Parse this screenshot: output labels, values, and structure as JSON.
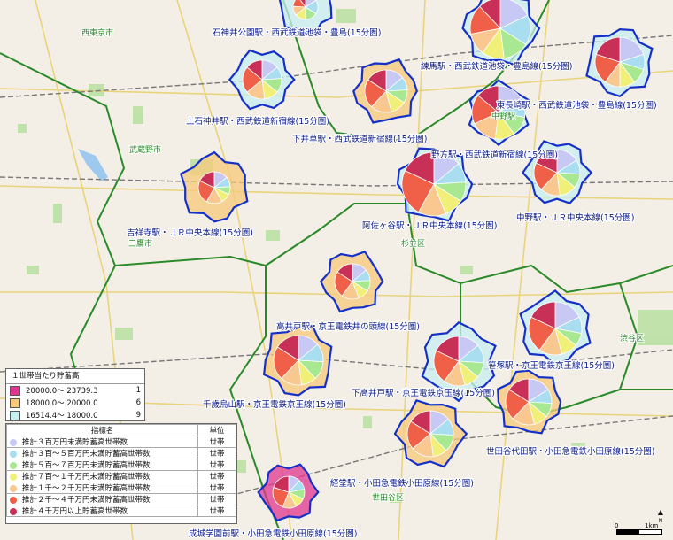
{
  "map": {
    "cities": [
      "西東京市",
      "武蔵野市",
      "三鷹市",
      "中野区",
      "杉並区",
      "渋谷区",
      "世田谷区"
    ],
    "stations": [
      {
        "label": "石神井公園駅・西武鉄道池袋・豊島(15分圏)",
        "tier": "c",
        "pie": [
          0.16,
          0.18,
          0.16,
          0.14,
          0.12,
          0.14,
          0.1
        ]
      },
      {
        "label": "練馬駅・西武鉄道池袋・豊島線(15分圏)",
        "tier": "c",
        "pie": [
          0.18,
          0.16,
          0.14,
          0.12,
          0.12,
          0.16,
          0.12
        ]
      },
      {
        "label": "上石神井駅・西武鉄道新宿線(15分圏)",
        "tier": "c",
        "pie": [
          0.14,
          0.1,
          0.12,
          0.12,
          0.16,
          0.22,
          0.14
        ]
      },
      {
        "label": "下井草駅・西武鉄道新宿線(15分圏)",
        "tier": "b",
        "pie": [
          0.14,
          0.1,
          0.1,
          0.12,
          0.16,
          0.22,
          0.16
        ]
      },
      {
        "label": "東長崎駅・西武鉄道池袋・豊島線(15分圏)",
        "tier": "c",
        "pie": [
          0.2,
          0.1,
          0.1,
          0.1,
          0.1,
          0.2,
          0.2
        ]
      },
      {
        "label": "野方駅・西武鉄道新宿線(15分圏)",
        "tier": "c",
        "pie": [
          0.16,
          0.12,
          0.12,
          0.12,
          0.16,
          0.18,
          0.14
        ]
      },
      {
        "label": "吉祥寺駅・ＪＲ中央本線(15分圏)",
        "tier": "b",
        "pie": [
          0.14,
          0.1,
          0.08,
          0.1,
          0.16,
          0.24,
          0.18
        ]
      },
      {
        "label": "阿佐ヶ谷駅・ＪＲ中央本線(15分圏)",
        "tier": "c",
        "pie": [
          0.14,
          0.1,
          0.1,
          0.1,
          0.14,
          0.24,
          0.18
        ]
      },
      {
        "label": "中野駅・ＪＲ中央本線(15分圏)",
        "tier": "c",
        "pie": [
          0.16,
          0.1,
          0.1,
          0.12,
          0.14,
          0.2,
          0.18
        ]
      },
      {
        "label": "高井戸駅・京王電鉄井の頭線(15分圏)",
        "tier": "b",
        "pie": [
          0.14,
          0.1,
          0.1,
          0.1,
          0.16,
          0.24,
          0.16
        ]
      },
      {
        "label": "千歳烏山駅・京王電鉄京王線(15分圏)",
        "tier": "b",
        "pie": [
          0.14,
          0.12,
          0.12,
          0.1,
          0.14,
          0.22,
          0.16
        ]
      },
      {
        "label": "下高井戸駅・京王電鉄京王線(15分圏)",
        "tier": "c",
        "pie": [
          0.14,
          0.12,
          0.1,
          0.1,
          0.14,
          0.22,
          0.18
        ]
      },
      {
        "label": "笹塚駅・京王電鉄京王線(15分圏)",
        "tier": "c",
        "pie": [
          0.18,
          0.1,
          0.08,
          0.1,
          0.14,
          0.22,
          0.18
        ]
      },
      {
        "label": "世田谷代田駅・小田急電鉄小田原線(15分圏)",
        "tier": "b",
        "pie": [
          0.16,
          0.1,
          0.1,
          0.1,
          0.16,
          0.22,
          0.16
        ]
      },
      {
        "label": "経堂駅・小田急電鉄小田原線(15分圏)",
        "tier": "b",
        "pie": [
          0.14,
          0.12,
          0.12,
          0.1,
          0.16,
          0.2,
          0.16
        ]
      },
      {
        "label": "成城学園前駅・小田急電鉄小田原線(15分圏)",
        "tier": "a",
        "pie": [
          0.12,
          0.1,
          0.1,
          0.1,
          0.14,
          0.24,
          0.2
        ]
      }
    ],
    "center_label": "中野駅",
    "north_label": "N",
    "scale": {
      "zero": "0",
      "one": "1km"
    }
  },
  "legend_ranges": {
    "title": "１世帯当たり貯蓄高",
    "rows": [
      {
        "color": "#e0368f",
        "range": "20000.0～  23739.3",
        "count": "1"
      },
      {
        "color": "#f7c97a",
        "range": "18000.0～  20000.0",
        "count": "6"
      },
      {
        "color": "#c8eef0",
        "range": "16514.4～  18000.0",
        "count": "9"
      }
    ]
  },
  "legend_indicators": {
    "col_name": "指標名",
    "col_unit": "単位",
    "rows": [
      {
        "color": "#c8c8f5",
        "name": "推計３百万円未満貯蓄高世帯数",
        "unit": "世帯"
      },
      {
        "color": "#a8def0",
        "name": "推計３百～５百万円未満貯蓄高世帯数",
        "unit": "世帯"
      },
      {
        "color": "#a8e890",
        "name": "推計５百～７百万円未満貯蓄高世帯数",
        "unit": "世帯"
      },
      {
        "color": "#f0f078",
        "name": "推計７百～１千万円未満貯蓄高世帯数",
        "unit": "世帯"
      },
      {
        "color": "#f8c890",
        "name": "推計１千～２千万円未満貯蓄高世帯数",
        "unit": "世帯"
      },
      {
        "color": "#f06048",
        "name": "推計２千～４千万円未満貯蓄高世帯数",
        "unit": "世帯"
      },
      {
        "color": "#c83058",
        "name": "推計４千万円以上貯蓄高世帯数",
        "unit": "世帯"
      }
    ]
  },
  "tier_colors": {
    "a": "#e0368f",
    "b": "#f7c97a",
    "c": "#c8eef0"
  },
  "pie_colors": [
    "#c8c8f5",
    "#a8def0",
    "#a8e890",
    "#f0f078",
    "#f8c890",
    "#f06048",
    "#c83058"
  ]
}
